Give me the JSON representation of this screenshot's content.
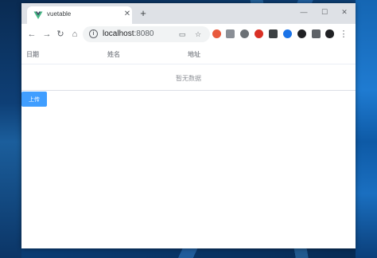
{
  "browser": {
    "tab_title": "vuetable",
    "tab_close": "✕",
    "new_tab": "+",
    "url_host": "localhost",
    "url_port": ":8080",
    "controls": {
      "minimize": "—",
      "maximize": "☐",
      "close": "✕"
    }
  },
  "nav": {
    "back": "←",
    "forward": "→",
    "reload": "↻",
    "home": "⌂"
  },
  "table": {
    "columns": [
      "日期",
      "姓名",
      "地址"
    ],
    "empty_text": "暂无数据"
  },
  "actions": {
    "upload_label": "上传"
  },
  "colors": {
    "primary": "#409eff",
    "vue_green": "#41b883",
    "vue_dark": "#35495e"
  }
}
